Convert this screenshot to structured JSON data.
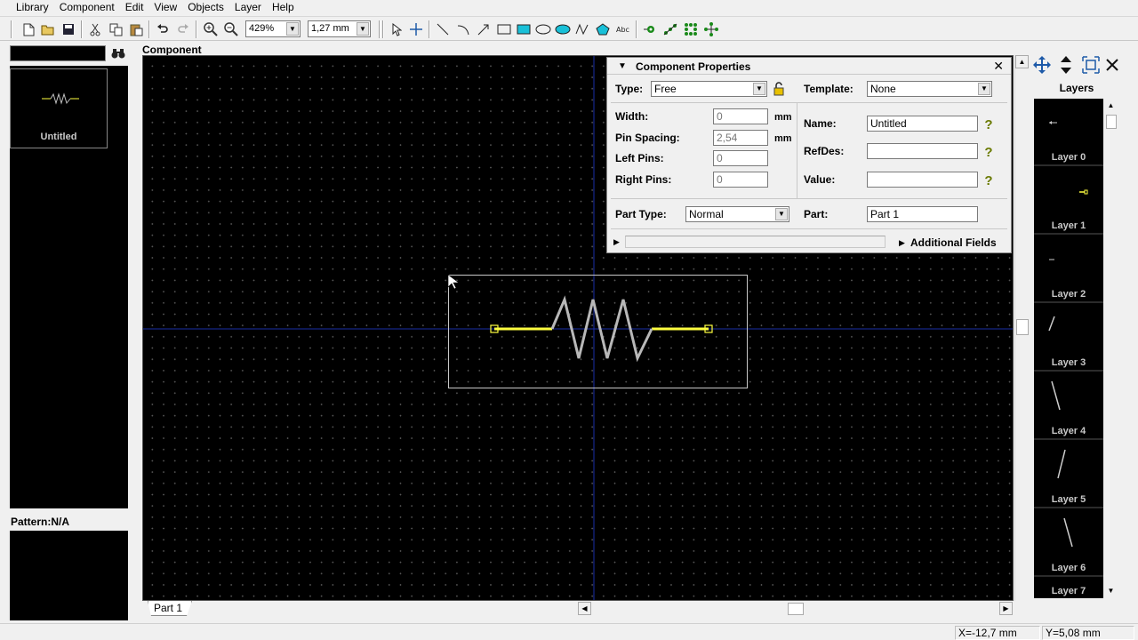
{
  "menu": [
    "Library",
    "Component",
    "Edit",
    "View",
    "Objects",
    "Layer",
    "Help"
  ],
  "toolbar": {
    "zoom_value": "429%",
    "grid_value": "1,27 mm"
  },
  "library_panel": {
    "item_label": "Untitled",
    "pattern_label": "Pattern:N/A"
  },
  "canvas": {
    "title": "Component",
    "tab": "Part 1"
  },
  "component_properties": {
    "title": "Component Properties",
    "type_label": "Type:",
    "type_value": "Free",
    "template_label": "Template:",
    "template_value": "None",
    "width_label": "Width:",
    "width_value": "0",
    "width_unit": "mm",
    "pin_spacing_label": "Pin Spacing:",
    "pin_spacing_value": "2,54",
    "pin_spacing_unit": "mm",
    "left_pins_label": "Left Pins:",
    "left_pins_value": "0",
    "right_pins_label": "Right Pins:",
    "right_pins_value": "0",
    "name_label": "Name:",
    "name_value": "Untitled",
    "refdes_label": "RefDes:",
    "refdes_value": "",
    "value_label": "Value:",
    "value_value": "",
    "part_type_label": "Part Type:",
    "part_type_value": "Normal",
    "part_label": "Part:",
    "part_value": "Part 1",
    "additional_fields": "Additional Fields",
    "close_glyph": "✕"
  },
  "layers": {
    "title": "Layers",
    "items": [
      "Layer 0",
      "Layer 1",
      "Layer 2",
      "Layer 3",
      "Layer 4",
      "Layer 5",
      "Layer 6",
      "Layer 7"
    ]
  },
  "status": {
    "x": "X=-12,7 mm",
    "y": "Y=5,08 mm"
  },
  "colors": {
    "canvas_bg": "#000000",
    "axis": "#1a2ea8",
    "pin": "#ffff40",
    "body": "#c0c0c0",
    "help_icon": "#6a7a00",
    "tool_blue": "#1e5aa8"
  }
}
